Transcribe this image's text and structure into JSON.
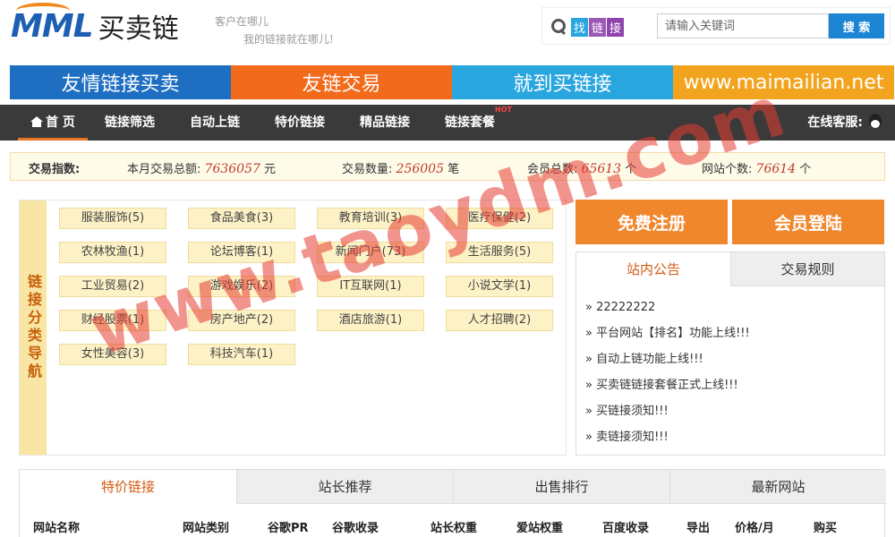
{
  "header": {
    "logo_mark": "MML",
    "logo_name": "买卖链",
    "slogan_line1": "客户在哪儿",
    "slogan_line2": "我的链接就在哪儿!",
    "find_tags": [
      "找",
      "链",
      "接"
    ],
    "search_placeholder": "请输入关键词",
    "search_button": "搜 索"
  },
  "banners": [
    {
      "label": "友情链接买卖",
      "color": "#1e6fc2"
    },
    {
      "label": "友链交易",
      "color": "#f26a1b"
    },
    {
      "label": "就到买链接",
      "color": "#2aa6df"
    },
    {
      "label": "www.maimailian.net",
      "color": "#f3a41f"
    }
  ],
  "nav": {
    "items": [
      "首 页",
      "链接筛选",
      "自动上链",
      "特价链接",
      "精品链接",
      "链接套餐"
    ],
    "hot_badge": "HOT",
    "online_service": "在线客服:"
  },
  "stats": {
    "label": "交易指数:",
    "monthly_total_label": "本月交易总额:",
    "monthly_total_value": "7636057",
    "monthly_total_unit": "元",
    "trade_count_label": "交易数量:",
    "trade_count_value": "256005",
    "trade_count_unit": "笔",
    "members_label": "会员总数:",
    "members_value": "65613",
    "members_unit": "个",
    "sites_label": "网站个数:",
    "sites_value": "76614",
    "sites_unit": "个"
  },
  "categories": {
    "title": "链接分类导航",
    "items": [
      "服装服饰(5)",
      "食品美食(3)",
      "教育培训(3)",
      "医疗保健(2)",
      "农林牧渔(1)",
      "论坛博客(1)",
      "新闻门户(73)",
      "生活服务(5)",
      "工业贸易(2)",
      "游戏娱乐(2)",
      "IT互联网(1)",
      "小说文学(1)",
      "财经股票(1)",
      "房产地产(2)",
      "酒店旅游(1)",
      "人才招聘(2)",
      "女性美容(3)",
      "科技汽车(1)"
    ]
  },
  "auth": {
    "register": "免费注册",
    "login": "会员登陆"
  },
  "notice": {
    "tabs": [
      "站内公告",
      "交易规则"
    ],
    "items": [
      "» 22222222",
      "» 平台网站【排名】功能上线!!!",
      "» 自动上链功能上线!!!",
      "» 买卖链链接套餐正式上线!!!",
      "» 买链接须知!!!",
      "» 卖链接须知!!!"
    ]
  },
  "bottom": {
    "tabs": [
      "特价链接",
      "站长推荐",
      "出售排行",
      "最新网站"
    ],
    "columns": [
      "网站名称",
      "网站类别",
      "谷歌PR",
      "谷歌收录",
      "站长权重",
      "爱站权重",
      "百度收录",
      "导出",
      "价格/月",
      "购买"
    ]
  },
  "watermark": "www.taoydm.com"
}
